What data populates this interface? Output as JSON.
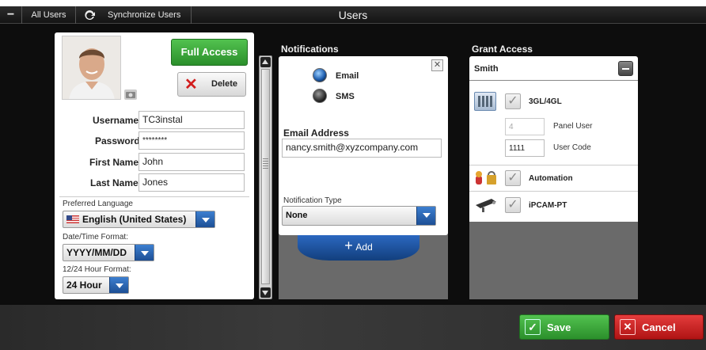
{
  "topbar": {
    "all_users": "All Users",
    "sync_users": "Synchronize Users",
    "title": "Users"
  },
  "user": {
    "full_access": "Full Access",
    "delete": "Delete",
    "username_label": "Username",
    "username": "TC3instal",
    "password_label": "Password",
    "password": "********",
    "first_name_label": "First Name",
    "first_name": "John",
    "last_name_label": "Last Name",
    "last_name": "Jones",
    "language_label": "Preferred Language",
    "language": "English (United States)",
    "date_label": "Date/Time Format:",
    "date_format": "YYYY/MM/DD",
    "hour_label": "12/24 Hour Format:",
    "hour_format": "24 Hour"
  },
  "notifications": {
    "header": "Notifications",
    "email": "Email",
    "sms": "SMS",
    "selected": "Email",
    "email_address_label": "Email Address",
    "email_address": "nancy.smith@xyzcompany.com",
    "type_label": "Notification Type",
    "type": "None",
    "add": "Add"
  },
  "grant": {
    "header": "Grant Access",
    "name": "Smith",
    "device": "3GL/4GL",
    "panel_user_value": "4",
    "panel_user_label": "Panel User",
    "user_code_value": "1111",
    "user_code_label": "User Code",
    "automation": "Automation",
    "ipcam": "iPCAM-PT"
  },
  "footer": {
    "save": "Save",
    "cancel": "Cancel"
  },
  "colors": {
    "accent_blue": "#2a66b8",
    "green": "#3aa83a",
    "red": "#cc2020"
  }
}
